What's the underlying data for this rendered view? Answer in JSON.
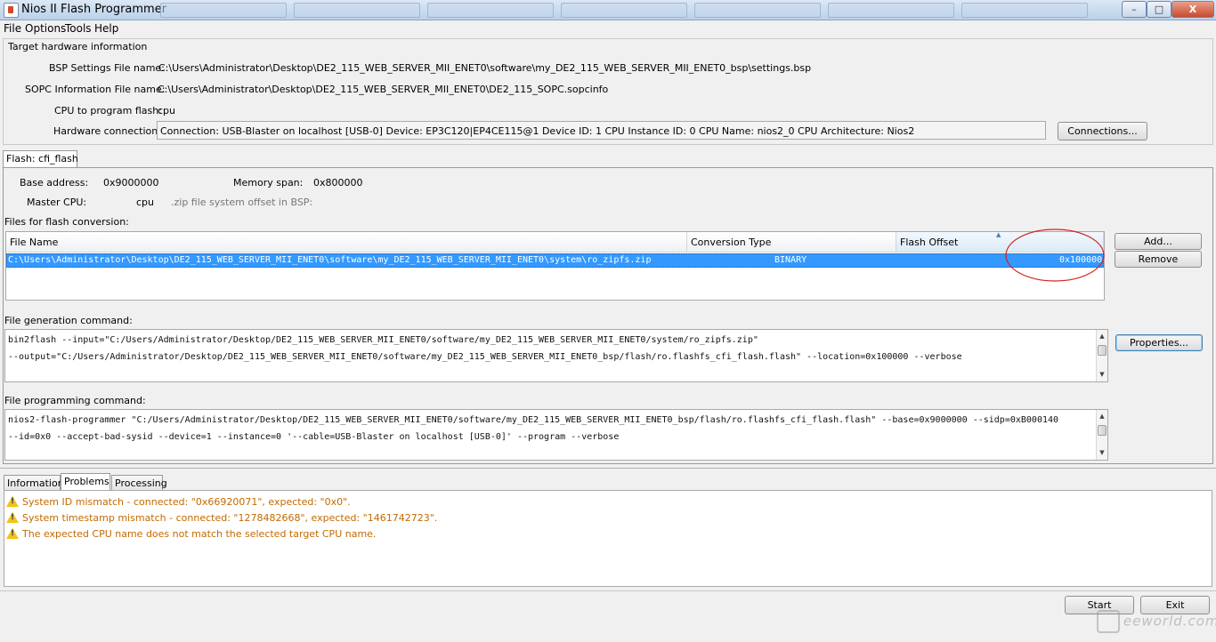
{
  "window": {
    "title": "Nios II Flash Programmer",
    "minimize": "–",
    "maximize": "□",
    "close": "X"
  },
  "menu": [
    "File",
    "Options",
    "Tools",
    "Help"
  ],
  "target": {
    "group_title": "Target hardware information",
    "bsp_label": "BSP Settings File name:",
    "bsp_value": "C:\\Users\\Administrator\\Desktop\\DE2_115_WEB_SERVER_MII_ENET0\\software\\my_DE2_115_WEB_SERVER_MII_ENET0_bsp\\settings.bsp",
    "sopc_label": "SOPC Information File name:",
    "sopc_value": "C:\\Users\\Administrator\\Desktop\\DE2_115_WEB_SERVER_MII_ENET0\\DE2_115_SOPC.sopcinfo",
    "cpu_label": "CPU to program flash:",
    "cpu_value": "cpu",
    "hw_label": "Hardware connection:",
    "hw_value": "Connection: USB-Blaster on localhost [USB-0]    Device: EP3C120|EP4CE115@1    Device ID: 1    CPU Instance ID: 0    CPU Name: nios2_0    CPU Architecture: Nios2",
    "connections_button": "Connections..."
  },
  "flash": {
    "tab": "Flash: cfi_flash",
    "base_label": "Base address:",
    "base_value": "0x9000000",
    "span_label": "Memory span:",
    "span_value": "0x800000",
    "master_label": "Master CPU:",
    "master_value": "cpu",
    "zip_label": ".zip file system offset in BSP:",
    "files_label": "Files for flash conversion:",
    "columns": [
      "File Name",
      "Conversion Type",
      "Flash Offset"
    ],
    "rows": [
      {
        "file": "C:\\Users\\Administrator\\Desktop\\DE2_115_WEB_SERVER_MII_ENET0\\software\\my_DE2_115_WEB_SERVER_MII_ENET0\\system\\ro_zipfs.zip",
        "type": "BINARY",
        "offset": "0x100000"
      }
    ],
    "add_button": "Add...",
    "remove_button": "Remove",
    "gen_label": "File generation command:",
    "gen_lines": [
      "bin2flash --input=\"C:/Users/Administrator/Desktop/DE2_115_WEB_SERVER_MII_ENET0/software/my_DE2_115_WEB_SERVER_MII_ENET0/system/ro_zipfs.zip\"",
      "--output=\"C:/Users/Administrator/Desktop/DE2_115_WEB_SERVER_MII_ENET0/software/my_DE2_115_WEB_SERVER_MII_ENET0_bsp/flash/ro.flashfs_cfi_flash.flash\" --location=0x100000 --verbose"
    ],
    "properties_button": "Properties...",
    "prog_label": "File programming command:",
    "prog_lines": [
      "nios2-flash-programmer \"C:/Users/Administrator/Desktop/DE2_115_WEB_SERVER_MII_ENET0/software/my_DE2_115_WEB_SERVER_MII_ENET0_bsp/flash/ro.flashfs_cfi_flash.flash\" --base=0x9000000 --sidp=0xB000140",
      "--id=0x0 --accept-bad-sysid --device=1 --instance=0 '--cable=USB-Blaster on localhost [USB-0]' --program --verbose"
    ]
  },
  "bottom_tabs": [
    "Information",
    "Problems",
    "Processing"
  ],
  "problems": [
    "System ID mismatch - connected: \"0x66920071\", expected: \"0x0\".",
    "System timestamp mismatch - connected: \"1278482668\", expected: \"1461742723\".",
    "The expected CPU name does not match the selected target CPU name."
  ],
  "actions": {
    "start": "Start",
    "exit": "Exit"
  },
  "watermark": "eeworld.com.cn",
  "colors": {
    "selection": "#3399ff",
    "warning_text": "#c26b00",
    "annotation": "#d22222"
  }
}
